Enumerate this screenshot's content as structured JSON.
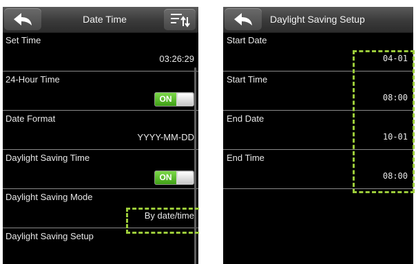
{
  "left": {
    "title": "Date Time",
    "back_icon": "back-arrow-icon",
    "menu_icon": "sort-menu-icon",
    "rows": [
      {
        "label": "Set Time",
        "value": "03:26:29"
      },
      {
        "label": "24-Hour Time",
        "toggle": "ON"
      },
      {
        "label": "Date Format",
        "value": "YYYY-MM-DD"
      },
      {
        "label": "Daylight Saving Time",
        "toggle": "ON"
      },
      {
        "label": "Daylight Saving Mode",
        "value": "By date/time"
      },
      {
        "label": "Daylight Saving Setup"
      }
    ]
  },
  "right": {
    "title": "Daylight Saving Setup",
    "back_icon": "back-arrow-icon",
    "rows": [
      {
        "label": "Start Date",
        "value": "04-01"
      },
      {
        "label": "Start Time",
        "value": "08:00"
      },
      {
        "label": "End Date",
        "value": "10-01"
      },
      {
        "label": "End Time",
        "value": "08:00"
      }
    ]
  },
  "colors": {
    "toggle_on": "#4caf1f",
    "highlight": "#9ccc3a",
    "background": "#000000"
  }
}
